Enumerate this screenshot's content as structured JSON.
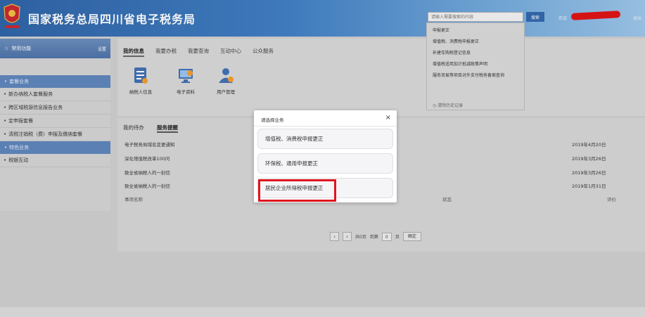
{
  "header": {
    "title": "国家税务总局四川省电子税务局",
    "search_placeholder": "请输入需要搜索的内容",
    "search_button": "搜索",
    "welcome": "欢迎",
    "exit": "退出",
    "brand_color": "#2c62a6"
  },
  "sidebar": {
    "header_label": "常用功能",
    "header_action": "设置",
    "groups": [
      {
        "label": "套餐业务",
        "items": [
          "新办纳税人套餐服务",
          "跨区域税源信息报告业务",
          "定申报套餐",
          "清税注销税（费）申报及缴纳套餐"
        ]
      },
      {
        "label": "特色业务",
        "items": [
          "税银互动"
        ]
      }
    ]
  },
  "top_tabs": [
    "我的信息",
    "我要办税",
    "我要查询",
    "互动中心",
    "公众服务"
  ],
  "tiles": [
    {
      "label": "纳税人信息",
      "icon": "taxpayer-info-icon"
    },
    {
      "label": "电子资料",
      "icon": "electronic-data-icon"
    },
    {
      "label": "用户管理",
      "icon": "user-management-icon"
    }
  ],
  "search_dropdown": {
    "items": [
      "申报更正",
      "增值税、消费税申报更正",
      "补建车购税登记信息",
      "增值税适用加计抵减政策声明",
      "服务贸易等项目对外支付税务备案查询"
    ],
    "clear_history": "清除历史记录"
  },
  "bottom_tabs": [
    "我的待办",
    "服务提醒"
  ],
  "notices": [
    {
      "title": "电子税务局域名变更通知",
      "date": "2019年4月20日"
    },
    {
      "title": "深化增值税改革100问",
      "date": "2019年3月26日"
    },
    {
      "title": "致全省纳税人的一封信",
      "date": "2019年3月26日"
    },
    {
      "title": "致全省纳税人的一封信",
      "date": "2019年1月31日"
    }
  ],
  "table_headers": [
    "事项名称",
    "状态",
    "评价"
  ],
  "pager": {
    "prev": "‹",
    "next": "›",
    "total_pages": "共0页",
    "goto": "到第",
    "page": "0",
    "unit": "页",
    "confirm": "确定"
  },
  "modal": {
    "title": "请选择业务",
    "close": "×",
    "options": [
      "增值税、消费税申报更正",
      "环保税、通用申报更正",
      "居民企业所得税申报更正"
    ],
    "highlight_color": "#e0141e"
  }
}
